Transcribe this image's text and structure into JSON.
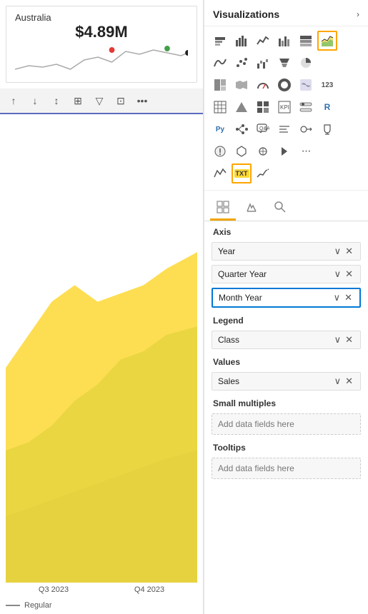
{
  "left": {
    "chart_card": {
      "country": "Australia",
      "value": "$4.89M"
    },
    "toolbar": {
      "buttons": [
        "↑",
        "↓",
        "↕",
        "⊞",
        "▽",
        "⊡",
        "•••"
      ]
    },
    "chart_labels": [
      "Q3 2023",
      "Q4 2023"
    ],
    "legend": {
      "line_label": "Regular"
    }
  },
  "right": {
    "header": {
      "title": "Visualizations",
      "chevron": "›"
    },
    "tabs": [
      {
        "id": "axis-tab",
        "icon": "⊞",
        "active": true
      },
      {
        "id": "format-tab",
        "icon": "🎨",
        "active": false
      },
      {
        "id": "analytics-tab",
        "icon": "🔍",
        "active": false
      }
    ],
    "sections": {
      "axis": {
        "label": "Axis",
        "fields": [
          {
            "name": "Year",
            "highlighted": false
          },
          {
            "name": "Quarter Year",
            "highlighted": false
          },
          {
            "name": "Month Year",
            "highlighted": true
          }
        ]
      },
      "legend": {
        "label": "Legend",
        "fields": [
          {
            "name": "Class",
            "highlighted": false
          }
        ]
      },
      "values": {
        "label": "Values",
        "fields": [
          {
            "name": "Sales",
            "highlighted": false
          }
        ]
      },
      "small_multiples": {
        "label": "Small multiples",
        "add_label": "Add data fields here"
      },
      "tooltips": {
        "label": "Tooltips",
        "add_label": "Add data fields here"
      }
    },
    "icons": {
      "rows": [
        [
          "▦",
          "bar",
          "☰",
          "⊞",
          "⊠",
          "⬚"
        ],
        [
          "〜",
          "△",
          "⟿",
          "⊿",
          "◫",
          ""
        ],
        [
          "⬕",
          "⊼",
          "▽",
          "◎",
          "◐",
          "123"
        ],
        [
          "⊞",
          "△",
          "⊞",
          "⊟",
          "⊠",
          "R"
        ],
        [
          "Py",
          "⊛",
          "⊡",
          "◫",
          "⊻",
          "🏆"
        ],
        [
          "📊",
          "🗺",
          "⬡",
          "➤",
          "⬘",
          ""
        ],
        [
          "👁",
          "TXT",
          "📈"
        ]
      ]
    }
  }
}
